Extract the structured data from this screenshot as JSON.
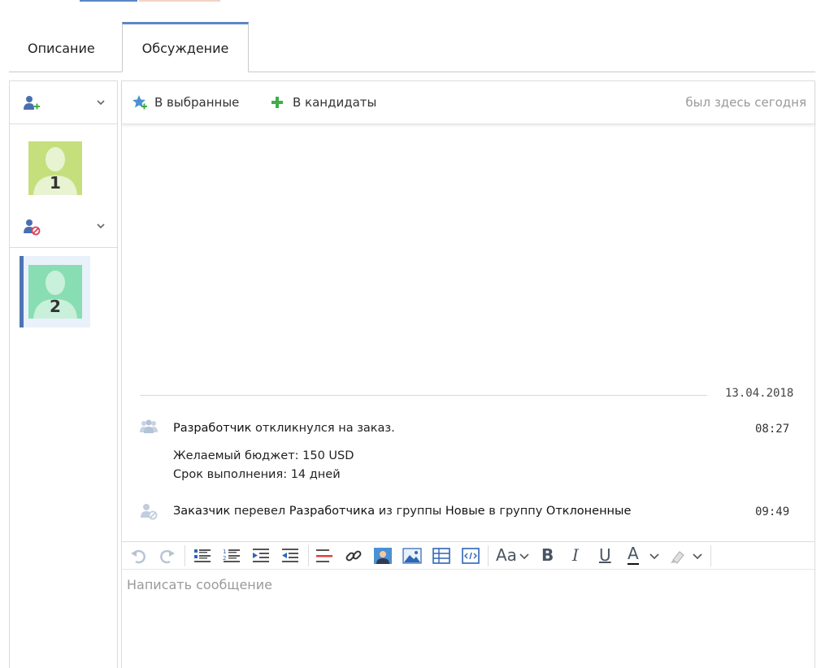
{
  "tabs": [
    {
      "label": "Описание",
      "active": false
    },
    {
      "label": "Обсуждение",
      "active": true
    }
  ],
  "sidebar": {
    "groups": [
      {
        "icon": "add-user-icon",
        "avatar_number": "1",
        "avatar_color": "#c6df7d"
      },
      {
        "icon": "blocked-user-icon",
        "avatar_number": "2",
        "avatar_color": "#88deb2"
      }
    ]
  },
  "toolbar": {
    "favorites_label": "В выбранные",
    "candidates_label": "В кандидаты",
    "status": "был здесь сегодня"
  },
  "chat": {
    "date": "13.04.2018",
    "events": [
      {
        "icon": "group-users-icon",
        "actor": "Разработчик",
        "text": " откликнулся на заказ.",
        "time": "08:27",
        "details": [
          "Желаемый бюджет: 150 USD",
          "Срок выполнения: 14 дней"
        ]
      },
      {
        "icon": "user-blocked-gray-icon",
        "actor": "Заказчик",
        "text_1": " перевел ",
        "actor_2": "Разработчика",
        "text_2": " из группы ",
        "group_from": "Новые",
        "text_3": " в группу ",
        "group_to": "Отклоненные",
        "time": "09:49"
      }
    ]
  },
  "editor": {
    "font_button": "Aa",
    "bold": "B",
    "italic": "I",
    "underline": "U",
    "text_color": "A",
    "placeholder": "Написать сообщение"
  },
  "colors": {
    "accent": "#5b87c5",
    "selected_bar": "#4f74b5",
    "green": "#3fae49"
  }
}
